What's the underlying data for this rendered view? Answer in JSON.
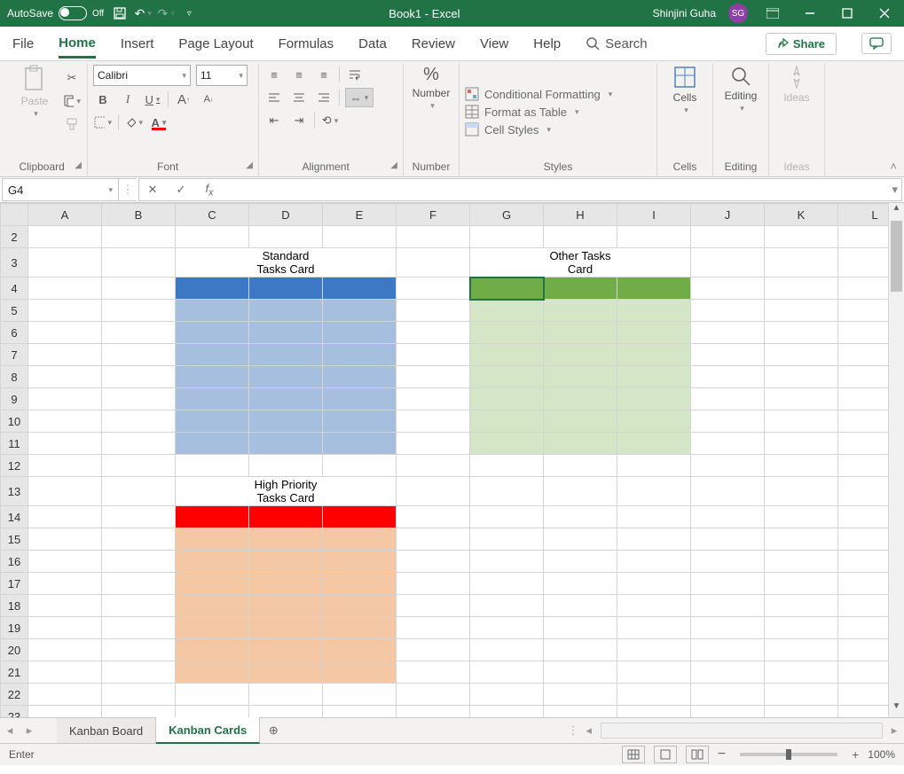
{
  "titlebar": {
    "autosave_label": "AutoSave",
    "autosave_state": "Off",
    "doc_title": "Book1  -  Excel",
    "user_name": "Shinjini Guha",
    "user_initials": "SG"
  },
  "tabs": {
    "file": "File",
    "home": "Home",
    "insert": "Insert",
    "page_layout": "Page Layout",
    "formulas": "Formulas",
    "data": "Data",
    "review": "Review",
    "view": "View",
    "help": "Help",
    "search": "Search",
    "share": "Share"
  },
  "ribbon": {
    "clipboard": {
      "paste": "Paste",
      "label": "Clipboard"
    },
    "font": {
      "name": "Calibri",
      "size": "11",
      "label": "Font"
    },
    "alignment": {
      "label": "Alignment"
    },
    "number": {
      "button": "Number",
      "label": "Number",
      "percent": "%"
    },
    "styles": {
      "cond": "Conditional Formatting",
      "table": "Format as Table",
      "cell": "Cell Styles",
      "label": "Styles"
    },
    "cells": {
      "button": "Cells",
      "label": "Cells"
    },
    "editing": {
      "button": "Editing",
      "label": "Editing"
    },
    "ideas": {
      "button": "Ideas",
      "label": "Ideas"
    }
  },
  "fbar": {
    "name": "G4",
    "formula": ""
  },
  "grid": {
    "columns": [
      "A",
      "B",
      "C",
      "D",
      "E",
      "F",
      "G",
      "H",
      "I",
      "J",
      "K",
      "L"
    ],
    "rows": [
      "2",
      "3",
      "4",
      "5",
      "6",
      "7",
      "8",
      "9",
      "10",
      "11",
      "12",
      "13",
      "14",
      "15",
      "16",
      "17",
      "18",
      "19",
      "20",
      "21",
      "22",
      "23"
    ],
    "selected_cell": "G4",
    "cards": {
      "standard": {
        "title": "Standard Tasks Card"
      },
      "other": {
        "title": "Other Tasks Card"
      },
      "high": {
        "title": "High Priority Tasks Card"
      }
    }
  },
  "sheets": {
    "tab1": "Kanban Board",
    "tab2": "Kanban Cards"
  },
  "status": {
    "mode": "Enter",
    "zoom": "100%"
  }
}
